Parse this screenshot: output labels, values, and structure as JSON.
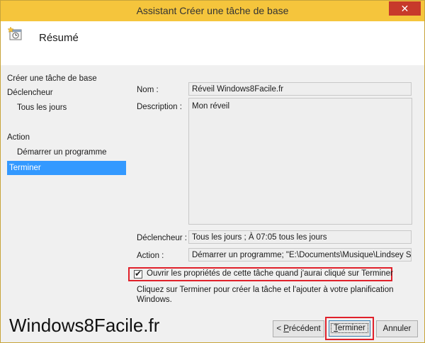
{
  "window": {
    "title": "Assistant Créer une tâche de base",
    "close_glyph": "✕"
  },
  "header": {
    "title": "Résumé",
    "icon": "task-scheduler-icon"
  },
  "nav": {
    "items": [
      {
        "label": "Créer une tâche de base"
      },
      {
        "label": "Déclencheur"
      },
      {
        "label": "Tous les jours"
      },
      {
        "label": "Action"
      },
      {
        "label": "Démarrer un programme"
      },
      {
        "label": "Terminer"
      }
    ]
  },
  "summary": {
    "name_label": "Nom :",
    "name_value": "Réveil Windows8Facile.fr",
    "description_label": "Description :",
    "description_value": "Mon réveil",
    "trigger_label": "Déclencheur :",
    "trigger_value": "Tous les jours ; À 07:05 tous les jours",
    "action_label": "Action :",
    "action_value": "Démarrer un programme; \"E:\\Documents\\Musique\\Lindsey Stirli"
  },
  "open_properties": {
    "label": "Ouvrir les propriétés de cette tâche quand j'aurai cliqué sur Terminer",
    "checked": true
  },
  "help_text": "Cliquez sur Terminer pour créer la tâche et l'ajouter à votre planification Windows.",
  "watermark": "Windows8Facile.fr",
  "buttons": {
    "previous_prefix": "< ",
    "previous_access": "P",
    "previous_rest": "récédent",
    "finish_access": "T",
    "finish_rest": "erminer",
    "cancel": "Annuler"
  },
  "colors": {
    "titlebar": "#f5c53c",
    "selected_nav": "#3399ff",
    "highlight_box": "#e0202a"
  }
}
